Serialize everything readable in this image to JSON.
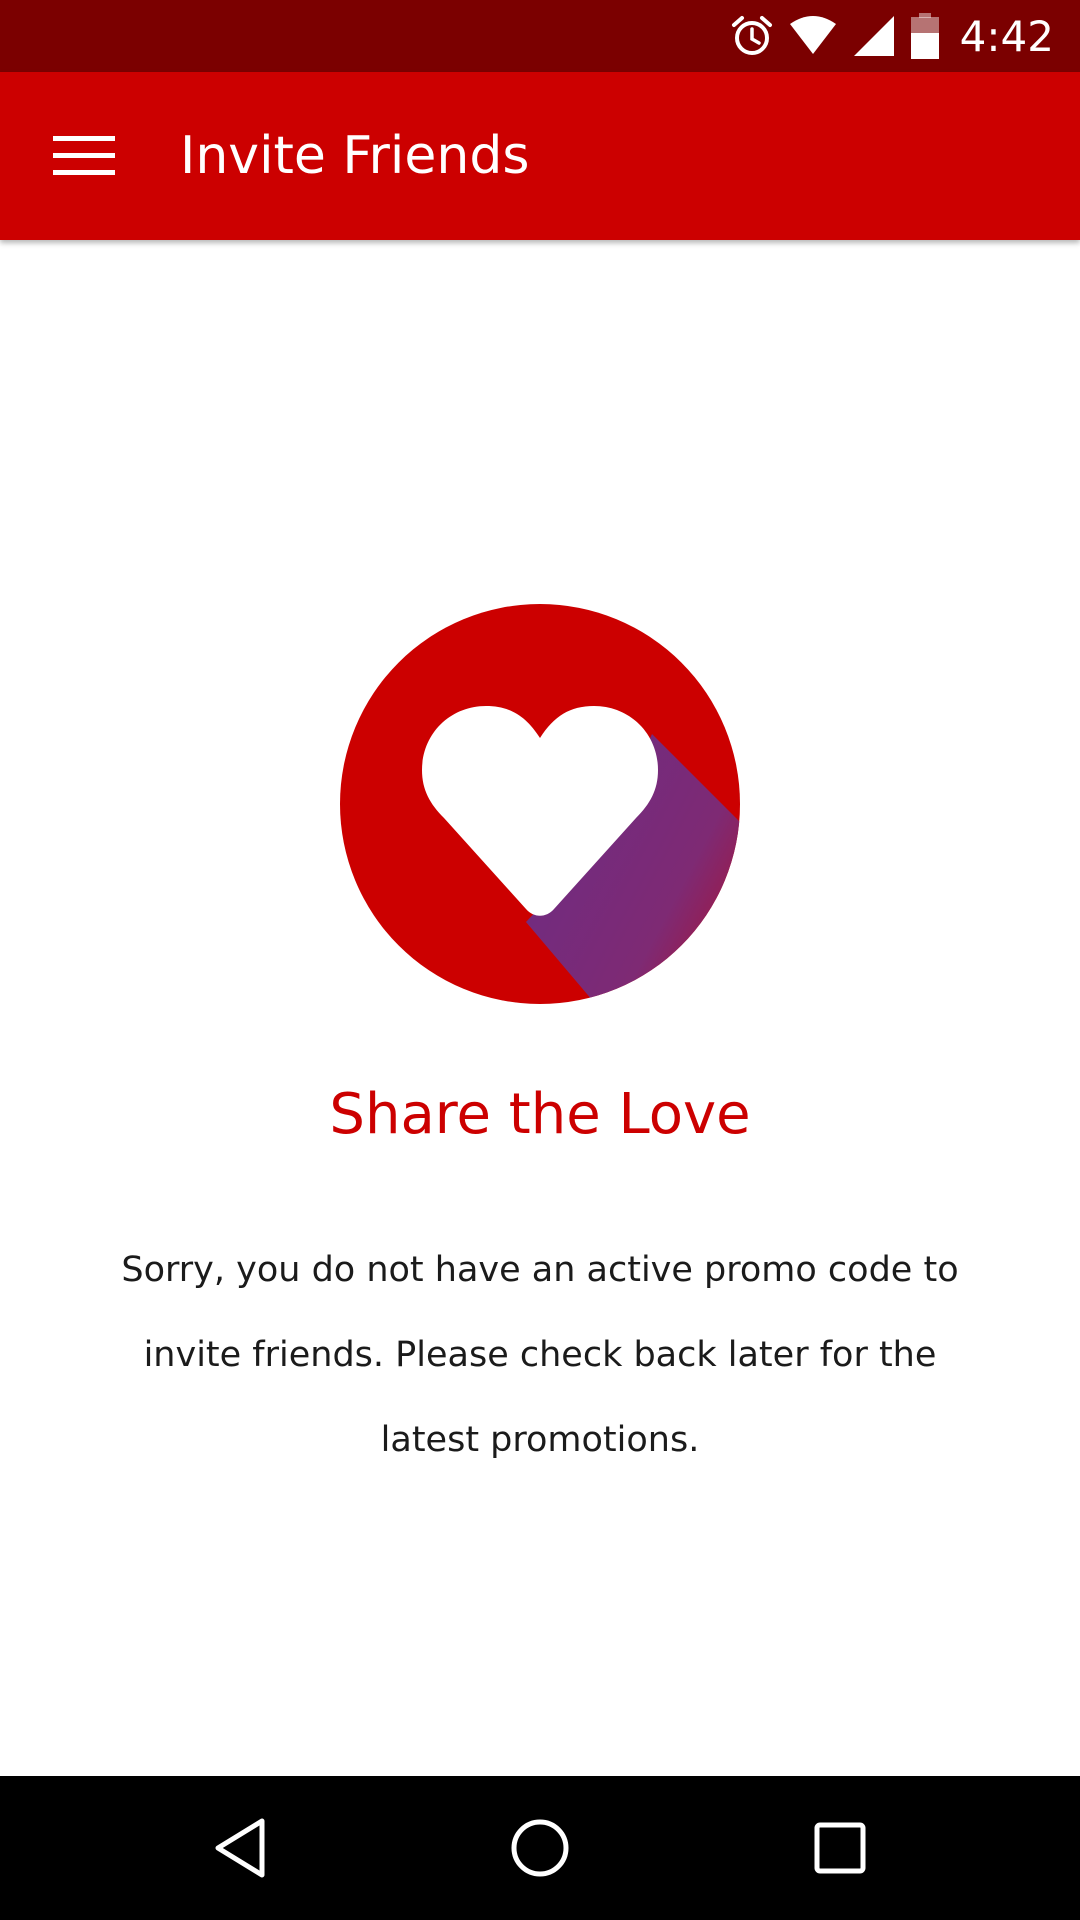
{
  "status_bar": {
    "time": "4:42",
    "icons": [
      "alarm-icon",
      "wifi-icon",
      "cell-signal-icon",
      "battery-icon"
    ]
  },
  "app_bar": {
    "menu_icon": "hamburger-menu-icon",
    "title": "Invite Friends",
    "color": "#cc0000"
  },
  "main": {
    "hero_icon": "heart-icon",
    "headline": "Share the Love",
    "message": "Sorry, you do not have an active promo code to invite friends. Please check back later for the latest promotions."
  },
  "nav_bar": {
    "back_icon": "back-triangle-icon",
    "home_icon": "home-circle-icon",
    "recents_icon": "recents-square-icon"
  },
  "colors": {
    "brand_red": "#cc0000",
    "status_bar": "#7b0000",
    "heart_shadow_purple": "#7a2a78"
  }
}
